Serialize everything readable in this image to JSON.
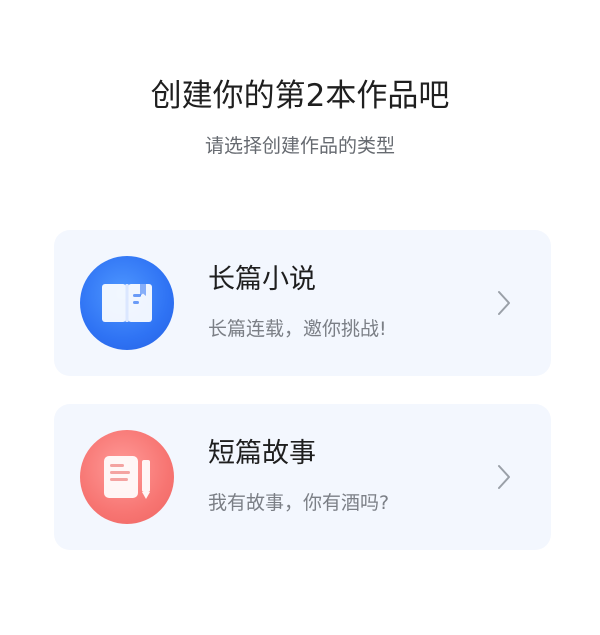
{
  "header": {
    "title": "创建你的第2本作品吧",
    "subtitle": "请选择创建作品的类型"
  },
  "options": [
    {
      "title": "长篇小说",
      "description": "长篇连载，邀你挑战!",
      "icon": "book-icon",
      "accent": "#2f73f4"
    },
    {
      "title": "短篇故事",
      "description": "我有故事，你有酒吗?",
      "icon": "note-pencil-icon",
      "accent": "#f77572"
    }
  ],
  "colors": {
    "card_background": "#f3f7fe",
    "title_text": "#1f1f1f",
    "secondary_text": "#7b7f86",
    "chevron": "#9aa0a8"
  }
}
